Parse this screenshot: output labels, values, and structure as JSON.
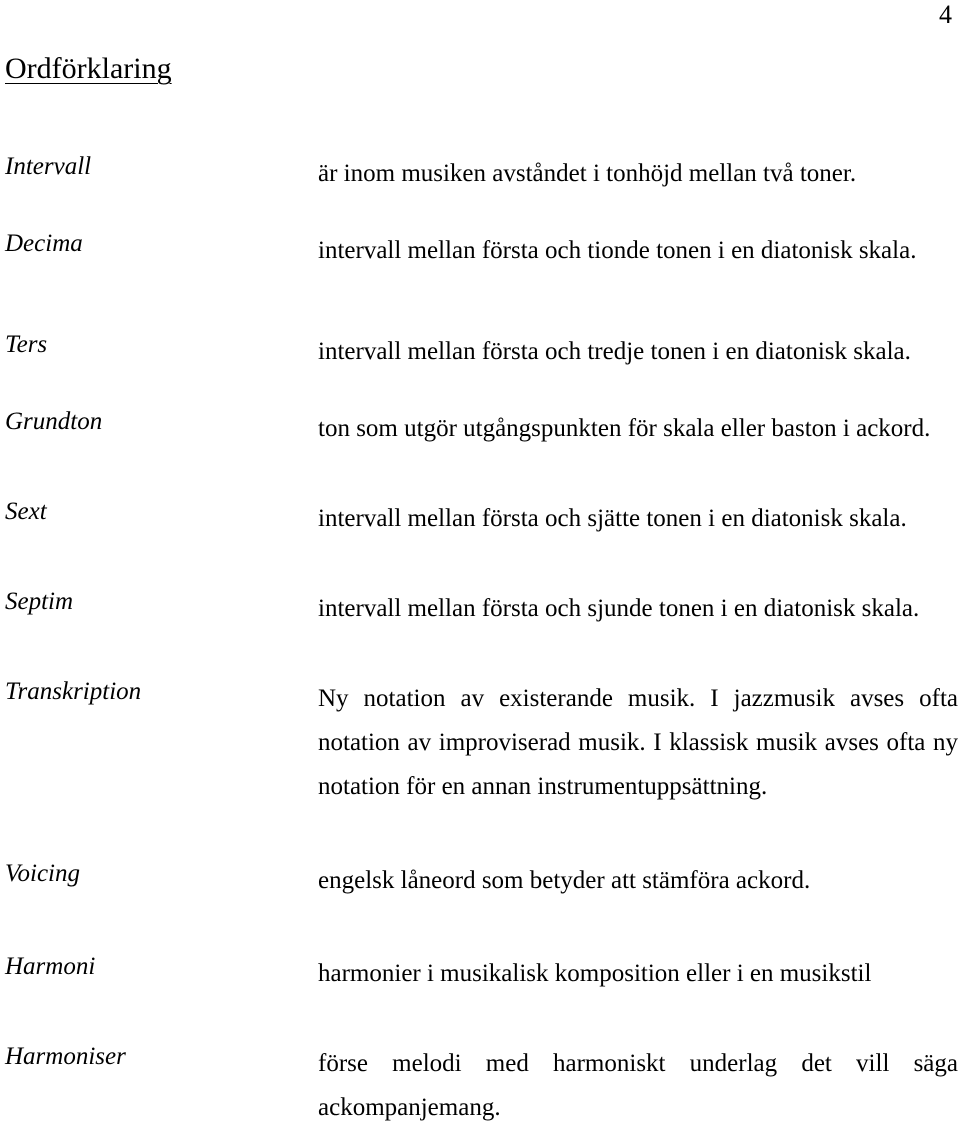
{
  "document": {
    "page_number": "4",
    "heading": "Ordförklaring"
  },
  "glossary": {
    "entries": [
      {
        "term": "Intervall",
        "definition": "är inom musiken avståndet i tonhöjd mellan två toner.",
        "multiline": false
      },
      {
        "term": "Decima",
        "definition": "intervall mellan första och tionde tonen i en diatonisk skala.",
        "multiline": false
      },
      {
        "term": "Ters",
        "definition": "intervall mellan första och tredje tonen i en diatonisk skala.",
        "multiline": false
      },
      {
        "term": "Grundton",
        "definition": "ton som utgör utgångspunkten för skala eller baston i ackord.",
        "multiline": false
      },
      {
        "term": "Sext",
        "definition": "intervall mellan första och sjätte tonen i en diatonisk skala.",
        "multiline": false
      },
      {
        "term": "Septim",
        "definition": "intervall mellan första och sjunde tonen i en diatonisk skala.",
        "multiline": false
      },
      {
        "term": "Transkription",
        "definition": "Ny notation av existerande musik. I jazzmusik avses ofta notation av improviserad musik. I klassisk musik avses ofta ny notation för en annan instrumentuppsättning.",
        "multiline": true
      },
      {
        "term": "Voicing",
        "definition": "engelsk låneord som betyder att stämföra ackord.",
        "multiline": false
      },
      {
        "term": "Harmoni",
        "definition": "harmonier i musikalisk komposition eller i en musikstil",
        "multiline": false
      },
      {
        "term": "Harmoniser",
        "definition": "förse melodi med harmoniskt underlag det vill säga ackompanjemang.",
        "multiline": true
      }
    ]
  }
}
